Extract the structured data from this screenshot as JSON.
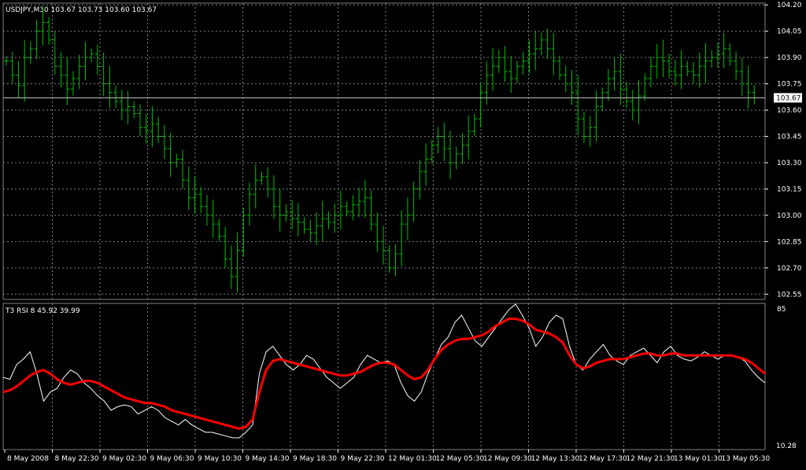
{
  "price_panel": {
    "header": "USDJPY,M30  103.67 103.73 103.60 103.67",
    "current_price_label": "103.67",
    "y_ticks": [
      "104.20",
      "104.05",
      "103.90",
      "103.75",
      "103.60",
      "103.45",
      "103.30",
      "103.15",
      "103.00",
      "102.85",
      "102.70",
      "102.55"
    ],
    "candle_color": "#00c000",
    "current_line_color": "#c0c0c0"
  },
  "rsi_panel": {
    "header": "T3 RSI 8 45.92 39.99",
    "y_ticks": [
      "85",
      "10.28"
    ],
    "rsi_color": "#ffffff",
    "t3_color": "#ff0000"
  },
  "x_axis": {
    "labels": [
      "8 May 2008",
      "8 May 22:30",
      "9 May 02:30",
      "9 May 06:30",
      "9 May 10:30",
      "9 May 14:30",
      "9 May 18:30",
      "9 May 22:30",
      "12 May 01:30",
      "12 May 05:30",
      "12 May 09:30",
      "12 May 13:30",
      "12 May 17:30",
      "12 May 21:30",
      "13 May 01:30",
      "13 May 05:30"
    ]
  },
  "colors": {
    "background": "#000000",
    "grid": "#808080",
    "axis_text": "#ffffff"
  },
  "chart_data": [
    {
      "type": "ohlc",
      "series_name": "USDJPY,M30",
      "ylim": [
        102.52,
        104.21
      ],
      "last": {
        "open": 103.67,
        "high": 103.73,
        "low": 103.6,
        "close": 103.67
      },
      "close_path": [
        103.88,
        103.8,
        103.74,
        103.9,
        103.95,
        104.05,
        104.1,
        104.0,
        103.85,
        103.8,
        103.72,
        103.78,
        103.85,
        103.9,
        103.92,
        103.85,
        103.75,
        103.7,
        103.65,
        103.6,
        103.62,
        103.58,
        103.5,
        103.48,
        103.52,
        103.45,
        103.38,
        103.3,
        103.32,
        103.2,
        103.1,
        103.12,
        103.05,
        103.0,
        102.95,
        102.88,
        102.75,
        102.65,
        102.8,
        103.0,
        103.12,
        103.2,
        103.22,
        103.15,
        103.05,
        103.0,
        103.02,
        102.98,
        102.96,
        102.92,
        102.9,
        102.94,
        102.98,
        102.96,
        103.0,
        103.05,
        103.02,
        103.06,
        103.08,
        103.1,
        102.95,
        102.85,
        102.8,
        102.7,
        102.78,
        102.95,
        103.0,
        103.15,
        103.25,
        103.32,
        103.4,
        103.45,
        103.38,
        103.3,
        103.35,
        103.4,
        103.48,
        103.55,
        103.7,
        103.8,
        103.85,
        103.9,
        103.82,
        103.78,
        103.85,
        103.88,
        103.92,
        103.95,
        104.0,
        103.95,
        103.88,
        103.8,
        103.75,
        103.7,
        103.55,
        103.45,
        103.5,
        103.62,
        103.7,
        103.78,
        103.82,
        103.72,
        103.65,
        103.6,
        103.68,
        103.78,
        103.85,
        103.9,
        103.88,
        103.82,
        103.8,
        103.85,
        103.82,
        103.8,
        103.85,
        103.88,
        103.9,
        103.92,
        103.95,
        103.88,
        103.82,
        103.75,
        103.7,
        103.67
      ]
    },
    {
      "type": "line",
      "ylim": [
        10.28,
        85
      ],
      "series": [
        {
          "name": "RSI",
          "values": [
            48,
            47,
            55,
            58,
            62,
            50,
            35,
            40,
            42,
            48,
            52,
            50,
            45,
            42,
            38,
            35,
            30,
            32,
            33,
            32,
            28,
            30,
            32,
            30,
            26,
            24,
            22,
            25,
            22,
            20,
            18,
            18,
            17,
            16,
            15,
            15,
            18,
            22,
            50,
            62,
            65,
            60,
            55,
            52,
            55,
            60,
            58,
            53,
            48,
            45,
            42,
            45,
            48,
            55,
            60,
            58,
            56,
            57,
            55,
            45,
            38,
            35,
            40,
            50,
            58,
            66,
            70,
            78,
            82,
            75,
            68,
            65,
            70,
            75,
            80,
            85,
            88,
            82,
            75,
            65,
            70,
            78,
            82,
            80,
            65,
            55,
            52,
            58,
            62,
            66,
            60,
            57,
            55,
            60,
            62,
            64,
            60,
            56,
            62,
            65,
            60,
            58,
            57,
            59,
            62,
            60,
            58,
            60,
            60,
            59,
            57,
            52,
            48,
            45
          ]
        },
        {
          "name": "T3",
          "values": [
            40,
            41,
            43,
            46,
            49,
            51,
            52,
            50,
            47,
            45,
            44,
            45,
            46,
            46,
            45,
            43,
            41,
            39,
            37,
            36,
            35,
            34,
            34,
            33,
            32,
            30,
            29,
            28,
            27,
            26,
            25,
            24,
            23,
            22,
            21,
            20,
            21,
            25,
            40,
            52,
            57,
            58,
            57,
            56,
            55,
            54,
            53,
            52,
            51,
            50,
            49,
            49,
            50,
            51,
            53,
            55,
            56,
            56,
            55,
            52,
            49,
            47,
            48,
            52,
            58,
            63,
            66,
            68,
            69,
            69,
            70,
            71,
            73,
            76,
            78,
            80,
            80,
            79,
            77,
            74,
            73,
            72,
            70,
            67,
            60,
            55,
            53,
            54,
            56,
            57,
            58,
            58,
            58,
            59,
            60,
            61,
            61,
            60,
            60,
            61,
            61,
            60,
            60,
            60,
            60,
            60,
            60,
            60,
            60,
            59,
            58,
            56,
            53,
            50
          ]
        }
      ]
    }
  ]
}
